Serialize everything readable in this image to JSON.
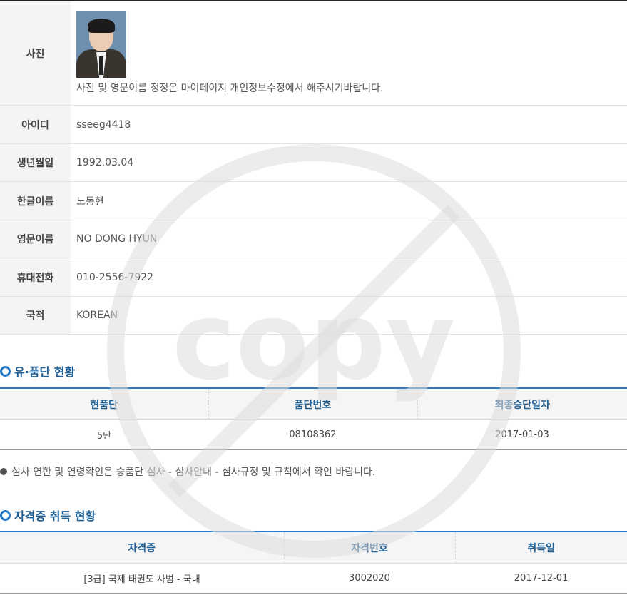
{
  "profile": {
    "photo_label": "사진",
    "photo_note": "사진 및 영문이름 정정은 마이페이지 개인정보수정에서 해주시기바랍니다.",
    "rows": [
      {
        "label": "아이디",
        "value": "sseeg4418"
      },
      {
        "label": "생년월일",
        "value": "1992.03.04"
      },
      {
        "label": "한글이름",
        "value": "노동현"
      },
      {
        "label": "영문이름",
        "value": "NO DONG HYUN"
      },
      {
        "label": "휴대전화",
        "value": "010-2556-7922"
      },
      {
        "label": "국적",
        "value": "KOREAN"
      }
    ]
  },
  "dan_section": {
    "title": "유·품단 현황",
    "headers": [
      "현품단",
      "품단번호",
      "최종승단일자"
    ],
    "row": [
      "5단",
      "08108362",
      "2017-01-03"
    ]
  },
  "notice": "심사 연한 및 연령확인은 승품단 심사 - 심사안내 - 심사규정 및 규칙에서 확인 바랍니다.",
  "cert_section": {
    "title": "자격증 취득 현황",
    "headers": [
      "자격증",
      "자격번호",
      "취득일"
    ],
    "row": [
      "[3급] 국제 태권도 사범 - 국내",
      "3002020",
      "2017-12-01"
    ]
  },
  "watermark": {
    "text": "copy",
    "icon": "no-copy-prohibition-icon",
    "color": "#dcdcdc"
  },
  "colors": {
    "accent": "#2d7cc2",
    "heading": "#1f5f94"
  }
}
